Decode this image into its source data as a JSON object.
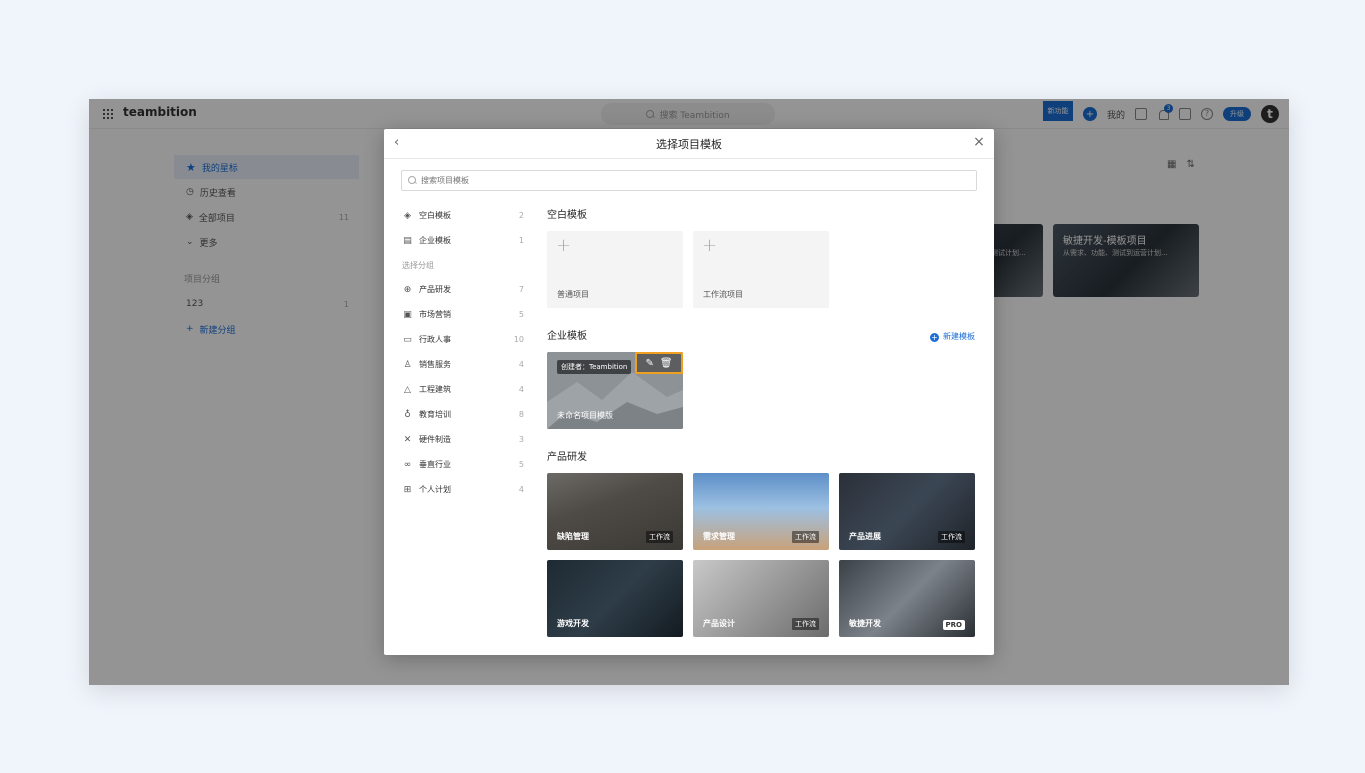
{
  "app": {
    "brand": "teambition",
    "search_placeholder": "搜索 Teambition",
    "new_feature": "新功能",
    "mine": "我的",
    "notification_count": "3",
    "upgrade": "升级",
    "avatar_letter": "t"
  },
  "sidebar": {
    "items": [
      {
        "label": "我的星标",
        "count": ""
      },
      {
        "label": "历史查看",
        "count": ""
      },
      {
        "label": "全部项目",
        "count": "11"
      },
      {
        "label": "更多",
        "count": ""
      }
    ],
    "group_title": "项目分组",
    "group_item": {
      "label": "123",
      "count": "1"
    },
    "add_group": "新建分组"
  },
  "bg_cards": [
    {
      "title": "",
      "subtitle": "需求设计开发测试计划..."
    },
    {
      "title": "敏捷开发-模板项目",
      "subtitle": "从需求、功能、测试到运营计划..."
    }
  ],
  "modal": {
    "title": "选择项目模板",
    "search_placeholder": "搜索项目模板",
    "categories_top": [
      {
        "label": "空白模板",
        "count": "2",
        "icon": "layers-icon"
      },
      {
        "label": "企业模板",
        "count": "1",
        "icon": "building-icon"
      }
    ],
    "group_header": "选择分组",
    "categories": [
      {
        "label": "产品研发",
        "count": "7",
        "icon": "globe-icon"
      },
      {
        "label": "市场营销",
        "count": "5",
        "icon": "bus-icon"
      },
      {
        "label": "行政人事",
        "count": "10",
        "icon": "monitor-icon"
      },
      {
        "label": "销售服务",
        "count": "4",
        "icon": "person-icon"
      },
      {
        "label": "工程建筑",
        "count": "4",
        "icon": "triangle-icon"
      },
      {
        "label": "教育培训",
        "count": "8",
        "icon": "medal-icon"
      },
      {
        "label": "硬件制造",
        "count": "3",
        "icon": "tools-icon"
      },
      {
        "label": "垂直行业",
        "count": "5",
        "icon": "infinity-icon"
      },
      {
        "label": "个人计划",
        "count": "4",
        "icon": "gift-icon"
      }
    ],
    "blank_section": {
      "title": "空白模板",
      "cards": [
        {
          "label": "普通项目"
        },
        {
          "label": "工作流项目"
        }
      ]
    },
    "enterprise_section": {
      "title": "企业模板",
      "new_template": "新建模板",
      "card": {
        "creator": "创建者：Teambition",
        "label": "未命名项目模版"
      }
    },
    "product_section": {
      "title": "产品研发",
      "cards": [
        {
          "label": "缺陷管理",
          "tag": "工作流"
        },
        {
          "label": "需求管理",
          "tag": "工作流"
        },
        {
          "label": "产品进展",
          "tag": "工作流"
        },
        {
          "label": "游戏开发",
          "tag": ""
        },
        {
          "label": "产品设计",
          "tag": "工作流"
        },
        {
          "label": "敏捷开发",
          "tag": "PRO"
        }
      ]
    }
  }
}
